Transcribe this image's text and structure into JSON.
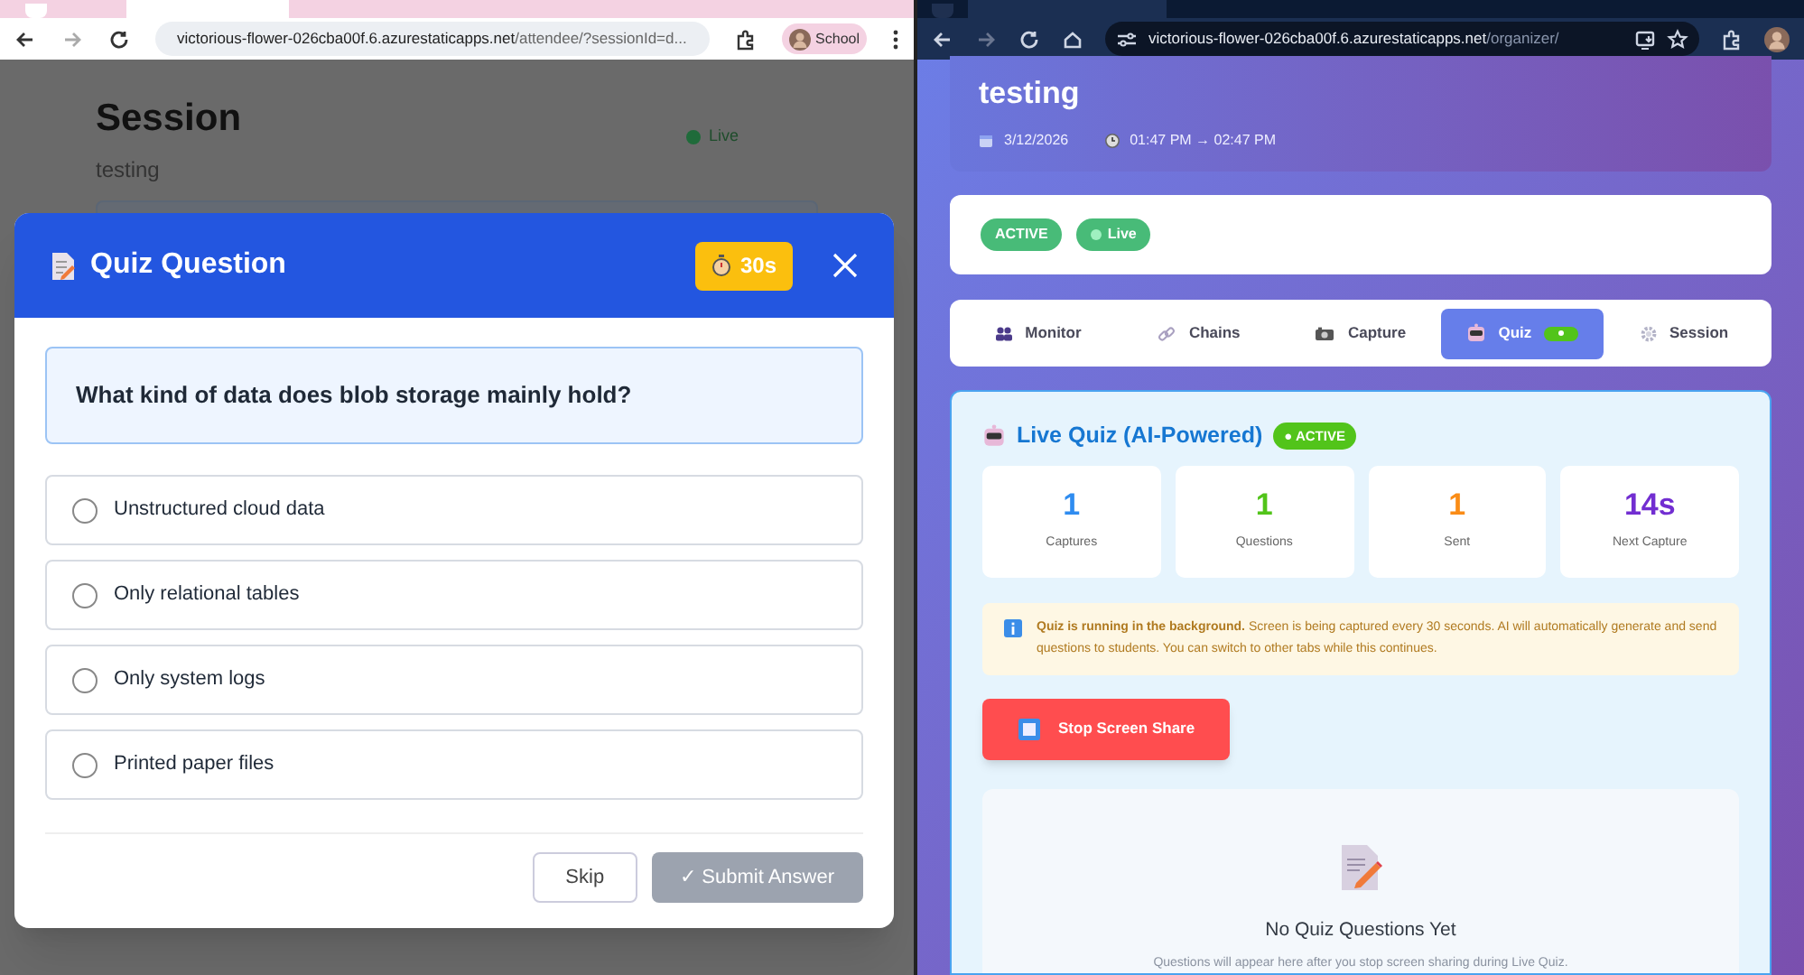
{
  "attendee_window": {
    "address": {
      "host": "victorious-flower-026cba00f.6.azurestaticapps.net",
      "path": "/attendee/?sessionId=d..."
    },
    "profile": "School",
    "page": {
      "title": "Session",
      "subtitle": "testing",
      "status": "Live"
    },
    "quiz_dialog": {
      "title": "Quiz Question",
      "timer": "30s",
      "question": "What kind of data does blob storage mainly hold?",
      "options": [
        {
          "label": "Unstructured cloud data",
          "selected": false
        },
        {
          "label": "Only relational tables",
          "selected": false
        },
        {
          "label": "Only system logs",
          "selected": false
        },
        {
          "label": "Printed paper files",
          "selected": false
        }
      ],
      "buttons": [
        {
          "label": "Skip",
          "disabled": false
        },
        {
          "label": "✓ Submit Answer",
          "disabled": true
        }
      ]
    }
  },
  "organizer_window": {
    "address": {
      "host": "victorious-flower-026cba00f.6.azurestaticapps.net",
      "path": "/organizer/"
    },
    "session": {
      "title": "testing",
      "date": "3/12/2026",
      "time": "01:47 PM → 02:47 PM"
    },
    "badges": [
      {
        "label": "ACTIVE",
        "dot": false
      },
      {
        "label": "Live",
        "dot": true
      }
    ],
    "tabs": [
      {
        "label": "Monitor",
        "selected": false,
        "running": false
      },
      {
        "label": "Chains",
        "selected": false,
        "running": false
      },
      {
        "label": "Capture",
        "selected": false,
        "running": false
      },
      {
        "label": "Quiz",
        "selected": true,
        "running": true
      },
      {
        "label": "Session",
        "selected": false,
        "running": false
      }
    ],
    "live_quiz": {
      "title": "Live Quiz (AI-Powered)",
      "status": "● ACTIVE",
      "stats": [
        {
          "value": "1",
          "label": "Captures",
          "color": "#2f8cf0"
        },
        {
          "value": "1",
          "label": "Questions",
          "color": "#52c41a"
        },
        {
          "value": "1",
          "label": "Sent",
          "color": "#fa8c16"
        },
        {
          "value": "14s",
          "label": "Next Capture",
          "color": "#722ed1"
        }
      ],
      "notice": "**Quiz is running in the background.** Screen is being captured every 30 seconds. AI will automatically generate and send questions to students. You can switch to other tabs while this continues.",
      "stop_button": "Stop Screen Share",
      "empty_state": {
        "title": "No Quiz Questions Yet",
        "text": "Questions will appear here after you stop screen sharing during Live Quiz."
      }
    }
  }
}
